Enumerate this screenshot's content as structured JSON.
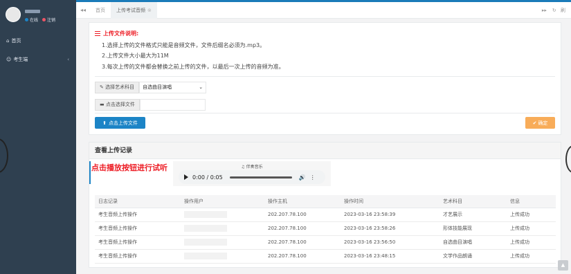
{
  "sidebar": {
    "status_online": "在线",
    "logout": "注销",
    "items": [
      {
        "label": "首页"
      },
      {
        "label": "考生端"
      }
    ]
  },
  "tabs": {
    "home": "首页",
    "active": "上传考试音频",
    "refresh": "刷"
  },
  "notice": {
    "title": "上传文件说明:",
    "lines": [
      "1.选择上传的文件格式只能是音频文件，文件后缀名必须为.mp3。",
      "2.上传文件大小最大为11M",
      "3.每次上传的文件都会替换之前上传的文件，以最后一次上传的音频为准。"
    ]
  },
  "form": {
    "select_label": "选择艺术科目",
    "select_value": "自选曲目演唱",
    "file_label": "点击选择文件",
    "upload_button": "点击上传文件",
    "confirm_button": "确定"
  },
  "records": {
    "title": "查看上传记录",
    "hint": "点击播放按钮进行试听",
    "player_title": "伴奏音乐",
    "player_time": "0:00 / 0:05",
    "columns": [
      "日志记录",
      "操作用户",
      "操作主机",
      "操作时间",
      "艺术科目",
      "信息"
    ],
    "rows": [
      [
        "考生音频上传操作",
        "",
        "202.207.78.100",
        "2023-03-16 23:58:39",
        "才艺展示",
        "上传成功"
      ],
      [
        "考生音频上传操作",
        "",
        "202.207.78.100",
        "2023-03-16 23:58:26",
        "形体技能展现",
        "上传成功"
      ],
      [
        "考生音频上传操作",
        "",
        "202.207.78.100",
        "2023-03-16 23:56:50",
        "自选曲目演唱",
        "上传成功"
      ],
      [
        "考生音频上传操作",
        "",
        "202.207.78.100",
        "2023-03-16 23:48:15",
        "文学作品朗诵",
        "上传成功"
      ]
    ]
  },
  "colors": {
    "sidebar": "#2f4050",
    "primary": "#1c84c6",
    "warning": "#f8ac59",
    "danger": "#ed1c24"
  }
}
